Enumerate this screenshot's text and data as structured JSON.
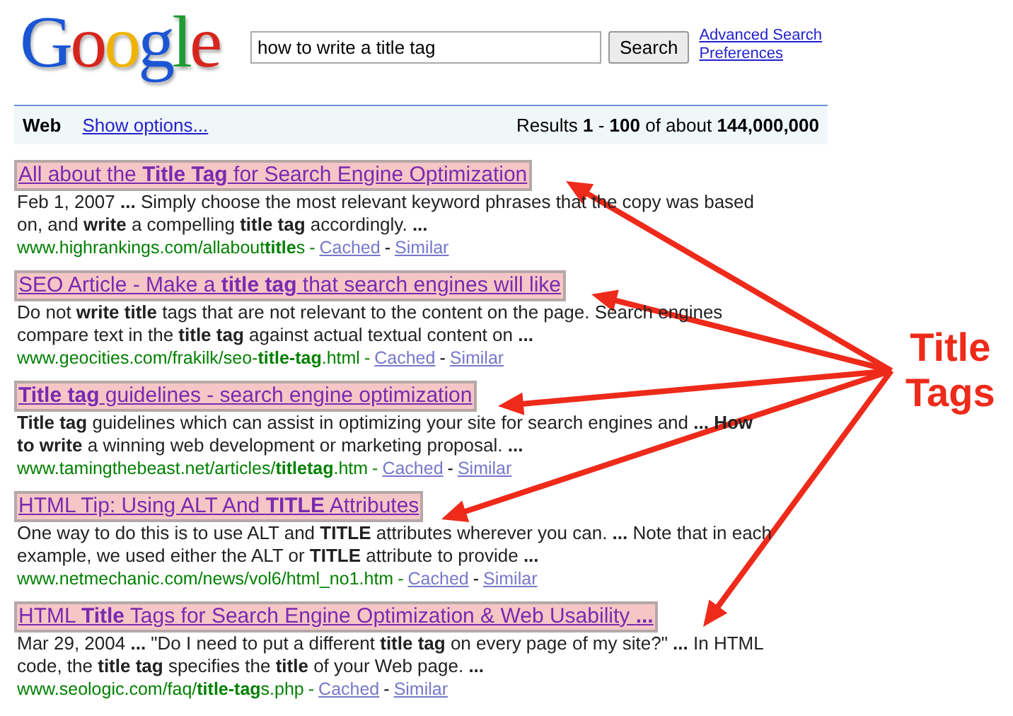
{
  "logo": "Google",
  "search": {
    "value": "how to write a title tag",
    "button": "Search"
  },
  "header_links": [
    "Advanced Search",
    "Preferences"
  ],
  "nav": {
    "tab": "Web",
    "options_link": "Show options...",
    "results": "Results **1** - **100** of about **144,000,000**"
  },
  "results": [
    {
      "title": "All about the **Title Tag** for Search Engine Optimization",
      "highlighted": true,
      "snippet": "Feb 1, 2007 **...** Simply choose the most relevant keyword phrases that the copy was based on, and **write** a compelling **title tag** accordingly. **...**",
      "url": "www.highrankings.com/allabout**title**s",
      "separator": "-",
      "cached": "Cached",
      "similar": "Similar"
    },
    {
      "title": "SEO Article - Make a **title tag** that search engines will like",
      "highlighted": true,
      "snippet": "Do not **write title** tags that are not relevant to the content on the page. Search engines compare text in the **title tag** against actual textual content on **...**",
      "url": "www.geocities.com/frakilk/seo-**title-tag**.html",
      "separator": "-",
      "cached": "Cached",
      "similar": "Similar"
    },
    {
      "title": "**Title tag** guidelines - search engine optimization",
      "highlighted": true,
      "snippet": "**Title tag** guidelines which can assist in optimizing your site for search engines and **... How to write** a winning web development or marketing proposal. **...**",
      "url": "www.tamingthebeast.net/articles/**titletag**.htm",
      "separator": "-",
      "cached": "Cached",
      "similar": "Similar"
    },
    {
      "title": "HTML Tip: Using ALT And **TITLE** Attributes",
      "highlighted": true,
      "snippet": "One way to do this is to use ALT and **TITLE** attributes wherever you can. **...** Note that in each example, we used either the ALT or **TITLE** attribute to provide **...**",
      "url": "www.netmechanic.com/news/vol6/html_no1.htm",
      "separator": "-",
      "cached": "Cached",
      "similar": "Similar"
    },
    {
      "title": "HTML **Title** Tags for Search Engine Optimization & Web Usability **...**",
      "highlighted": true,
      "snippet": "Mar 29, 2004 **...** \"Do I need to put a different **title tag** on every page of my site?\" **...** In HTML code, the **title tag** specifies the **title** of your Web page. **...**",
      "url": "www.seologic.com/faq/**title-tag**s.php",
      "separator": "-",
      "cached": "Cached",
      "similar": "Similar"
    }
  ],
  "annotation": {
    "label_lines": [
      "Title",
      "Tags"
    ]
  }
}
